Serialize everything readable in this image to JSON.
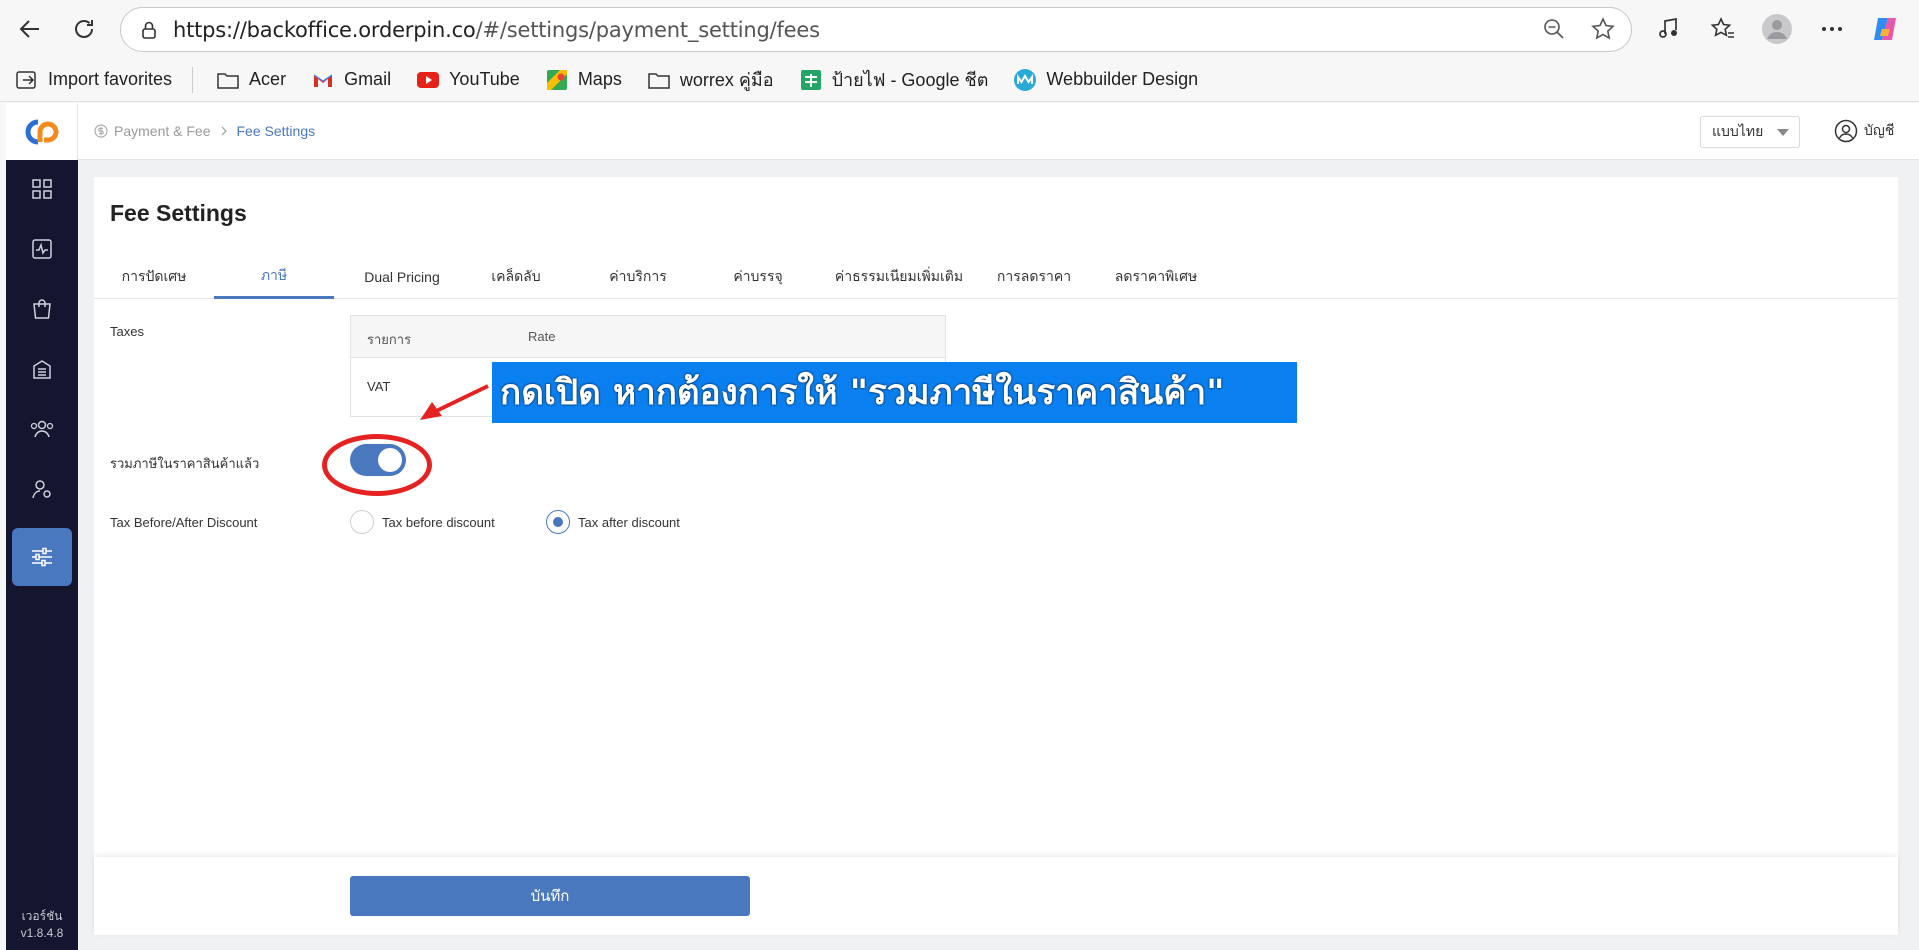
{
  "browser": {
    "url_host": "https://backoffice.orderpin.co",
    "url_path": "/#/settings/payment_setting/fees",
    "bookmarks": [
      {
        "label": "Import favorites",
        "icon": "import-icon"
      },
      {
        "label": "Acer",
        "icon": "folder-icon"
      },
      {
        "label": "Gmail",
        "icon": "gmail-icon"
      },
      {
        "label": "YouTube",
        "icon": "youtube-icon"
      },
      {
        "label": "Maps",
        "icon": "maps-icon"
      },
      {
        "label": "worrex คู่มือ",
        "icon": "folder-icon"
      },
      {
        "label": "ป้ายไฟ - Google ชีต",
        "icon": "sheets-icon"
      },
      {
        "label": "Webbuilder Design",
        "icon": "webbuilder-icon"
      }
    ]
  },
  "topbar": {
    "breadcrumb_parent": "Payment & Fee",
    "breadcrumb_current": "Fee Settings",
    "language": "แบบไทย",
    "account": "บัญชี"
  },
  "sidebar": {
    "version_label": "เวอร์ชัน",
    "version": "v1.8.4.8"
  },
  "page": {
    "title": "Fee Settings",
    "tabs": [
      {
        "label": "การปัดเศษ"
      },
      {
        "label": "ภาษี"
      },
      {
        "label": "Dual Pricing"
      },
      {
        "label": "เคล็ดลับ"
      },
      {
        "label": "ค่าบริการ"
      },
      {
        "label": "ค่าบรรจุ"
      },
      {
        "label": "ค่าธรรมเนียมเพิ่มเติม"
      },
      {
        "label": "การลดราคา"
      },
      {
        "label": "ลดราคาพิเศษ"
      }
    ],
    "active_tab": "ภาษี",
    "taxes_label": "Taxes",
    "table_col1": "รายการ",
    "table_col2": "Rate",
    "table_row1": "VAT",
    "include_tax_label": "รวมภาษีในราคาสินค้าแล้ว",
    "include_tax_on": true,
    "tax_order_label": "Tax Before/After Discount",
    "radio_before": "Tax before discount",
    "radio_after": "Tax after discount",
    "radio_selected": "Tax after discount",
    "save_label": "บันทึก"
  },
  "annotation": {
    "text": "กดเปิด หากต้องการให้ \"รวมภาษีในราคาสินค้า\"",
    "color": "#0a7ff0",
    "highlight_color": "#e52222"
  },
  "colors": {
    "accent": "#4a78bf",
    "sidebar_bg": "#14152e"
  }
}
